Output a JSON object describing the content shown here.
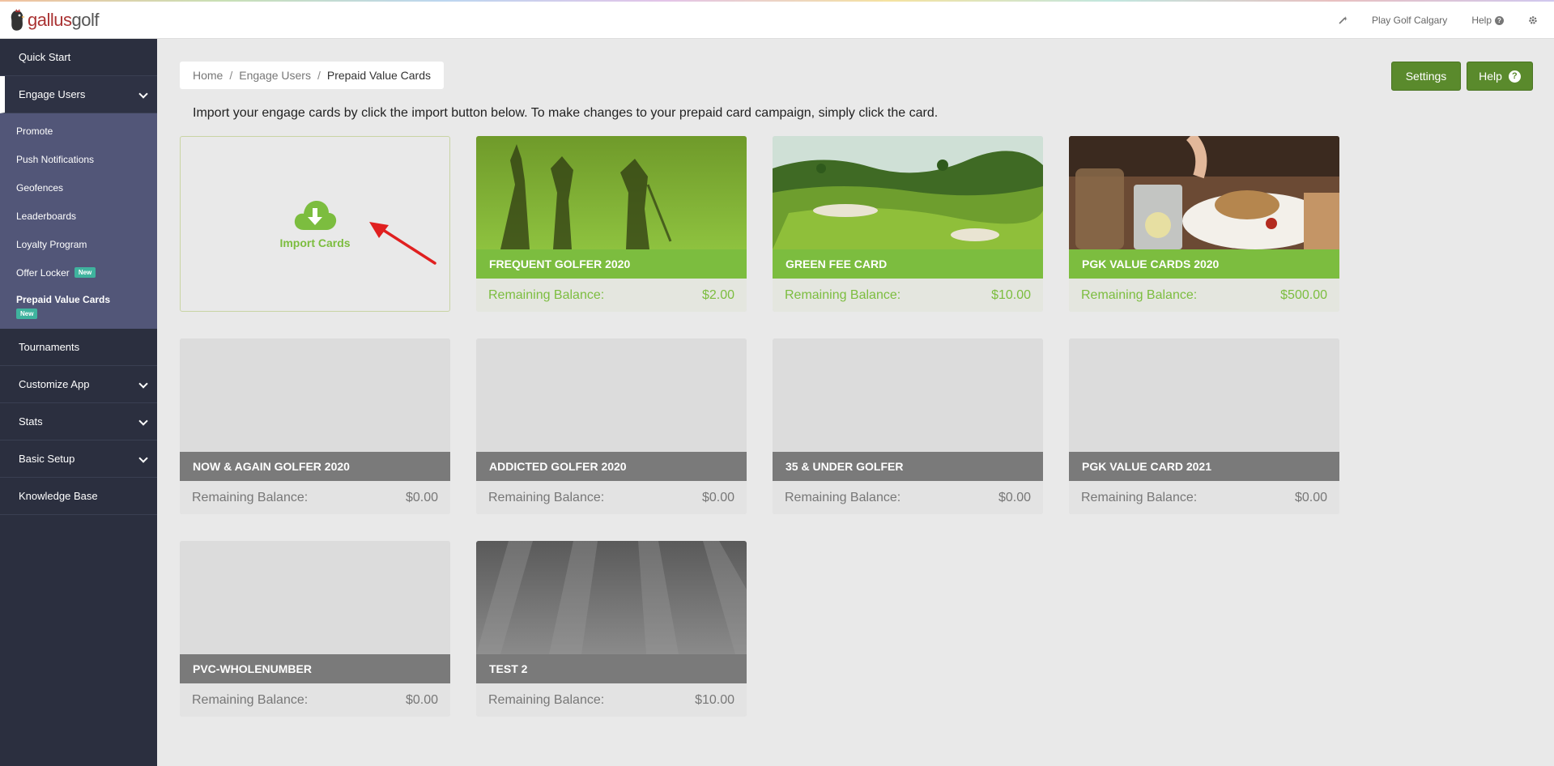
{
  "header": {
    "logo_main": "gallus",
    "logo_sub": "golf",
    "course": "Play Golf Calgary",
    "help": "Help"
  },
  "sidebar": {
    "quick_start": "Quick Start",
    "engage_users": "Engage Users",
    "sub_items": [
      "Promote",
      "Push Notifications",
      "Geofences",
      "Leaderboards",
      "Loyalty Program",
      "Offer Locker",
      "Prepaid Value Cards"
    ],
    "new_badge": "New",
    "tournaments": "Tournaments",
    "customize_app": "Customize App",
    "stats": "Stats",
    "basic_setup": "Basic Setup",
    "knowledge_base": "Knowledge Base"
  },
  "breadcrumb": {
    "home": "Home",
    "sep": "/",
    "section": "Engage Users",
    "current": "Prepaid Value Cards"
  },
  "buttons": {
    "settings": "Settings",
    "help": "Help"
  },
  "intro": "Import your engage cards by click the import button below. To make changes to your prepaid card campaign, simply click the card.",
  "import_label": "Import Cards",
  "balance_label": "Remaining Balance:",
  "cards": [
    {
      "title": "FREQUENT GOLFER 2020",
      "balance": "$2.00"
    },
    {
      "title": "GREEN FEE CARD",
      "balance": "$10.00"
    },
    {
      "title": "PGK VALUE CARDS 2020",
      "balance": "$500.00"
    },
    {
      "title": "NOW & AGAIN GOLFER 2020",
      "balance": "$0.00"
    },
    {
      "title": "ADDICTED GOLFER 2020",
      "balance": "$0.00"
    },
    {
      "title": "35 & UNDER GOLFER",
      "balance": "$0.00"
    },
    {
      "title": "PGK VALUE CARD 2021",
      "balance": "$0.00"
    },
    {
      "title": "PVC-WHOLENUMBER",
      "balance": "$0.00"
    },
    {
      "title": "TEST 2",
      "balance": "$10.00"
    }
  ],
  "colors": {
    "sidebar": "#2b2f3f",
    "subnav": "#525678",
    "accent_green": "#7cbd3f",
    "button_green": "#5a8a2c",
    "card_grey": "#7a7a7a",
    "arrow_red": "#e02020"
  }
}
